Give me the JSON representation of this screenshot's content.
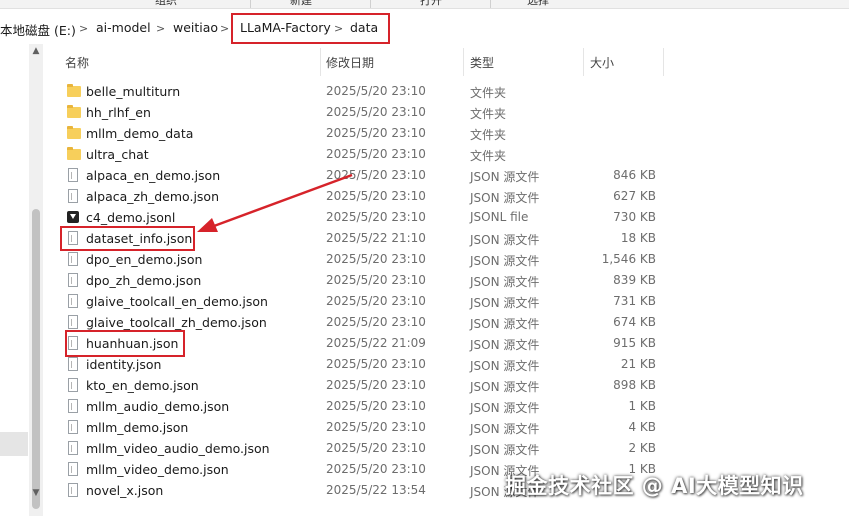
{
  "ribbon": {
    "items": [
      "组织",
      "新建",
      "打开",
      "选择"
    ]
  },
  "breadcrumb": [
    "本地磁盘 (E:)",
    "ai-model",
    "weitiao",
    "LLaMA-Factory",
    "data"
  ],
  "columns": {
    "name": "名称",
    "date": "修改日期",
    "type": "类型",
    "size": "大小"
  },
  "files": [
    {
      "name": "belle_multiturn",
      "date": "2025/5/20 23:10",
      "type": "文件夹",
      "size": "",
      "icon": "folder-icon"
    },
    {
      "name": "hh_rlhf_en",
      "date": "2025/5/20 23:10",
      "type": "文件夹",
      "size": "",
      "icon": "folder-icon"
    },
    {
      "name": "mllm_demo_data",
      "date": "2025/5/20 23:10",
      "type": "文件夹",
      "size": "",
      "icon": "folder-icon"
    },
    {
      "name": "ultra_chat",
      "date": "2025/5/20 23:10",
      "type": "文件夹",
      "size": "",
      "icon": "folder-icon"
    },
    {
      "name": "alpaca_en_demo.json",
      "date": "2025/5/20 23:10",
      "type": "JSON 源文件",
      "size": "846 KB",
      "icon": "json-file-icon"
    },
    {
      "name": "alpaca_zh_demo.json",
      "date": "2025/5/20 23:10",
      "type": "JSON 源文件",
      "size": "627 KB",
      "icon": "json-file-icon"
    },
    {
      "name": "c4_demo.jsonl",
      "date": "2025/5/20 23:10",
      "type": "JSONL file",
      "size": "730 KB",
      "icon": "jsonl-file-icon"
    },
    {
      "name": "dataset_info.json",
      "date": "2025/5/22 21:10",
      "type": "JSON 源文件",
      "size": "18 KB",
      "icon": "json-file-icon"
    },
    {
      "name": "dpo_en_demo.json",
      "date": "2025/5/20 23:10",
      "type": "JSON 源文件",
      "size": "1,546 KB",
      "icon": "json-file-icon"
    },
    {
      "name": "dpo_zh_demo.json",
      "date": "2025/5/20 23:10",
      "type": "JSON 源文件",
      "size": "839 KB",
      "icon": "json-file-icon"
    },
    {
      "name": "glaive_toolcall_en_demo.json",
      "date": "2025/5/20 23:10",
      "type": "JSON 源文件",
      "size": "731 KB",
      "icon": "json-file-icon"
    },
    {
      "name": "glaive_toolcall_zh_demo.json",
      "date": "2025/5/20 23:10",
      "type": "JSON 源文件",
      "size": "674 KB",
      "icon": "json-file-icon"
    },
    {
      "name": "huanhuan.json",
      "date": "2025/5/22 21:09",
      "type": "JSON 源文件",
      "size": "915 KB",
      "icon": "json-file-icon"
    },
    {
      "name": "identity.json",
      "date": "2025/5/20 23:10",
      "type": "JSON 源文件",
      "size": "21 KB",
      "icon": "json-file-icon"
    },
    {
      "name": "kto_en_demo.json",
      "date": "2025/5/20 23:10",
      "type": "JSON 源文件",
      "size": "898 KB",
      "icon": "json-file-icon"
    },
    {
      "name": "mllm_audio_demo.json",
      "date": "2025/5/20 23:10",
      "type": "JSON 源文件",
      "size": "1 KB",
      "icon": "json-file-icon"
    },
    {
      "name": "mllm_demo.json",
      "date": "2025/5/20 23:10",
      "type": "JSON 源文件",
      "size": "4 KB",
      "icon": "json-file-icon"
    },
    {
      "name": "mllm_video_audio_demo.json",
      "date": "2025/5/20 23:10",
      "type": "JSON 源文件",
      "size": "2 KB",
      "icon": "json-file-icon"
    },
    {
      "name": "mllm_video_demo.json",
      "date": "2025/5/20 23:10",
      "type": "JSON 源文件",
      "size": "1 KB",
      "icon": "json-file-icon"
    },
    {
      "name": "novel_x.json",
      "date": "2025/5/22 13:54",
      "type": "JSON 源文件",
      "size": "",
      "icon": "json-file-icon"
    }
  ],
  "annotation": {
    "color": "#d6232a"
  },
  "watermark": "掘金技术社区 @ AI大模型知识"
}
